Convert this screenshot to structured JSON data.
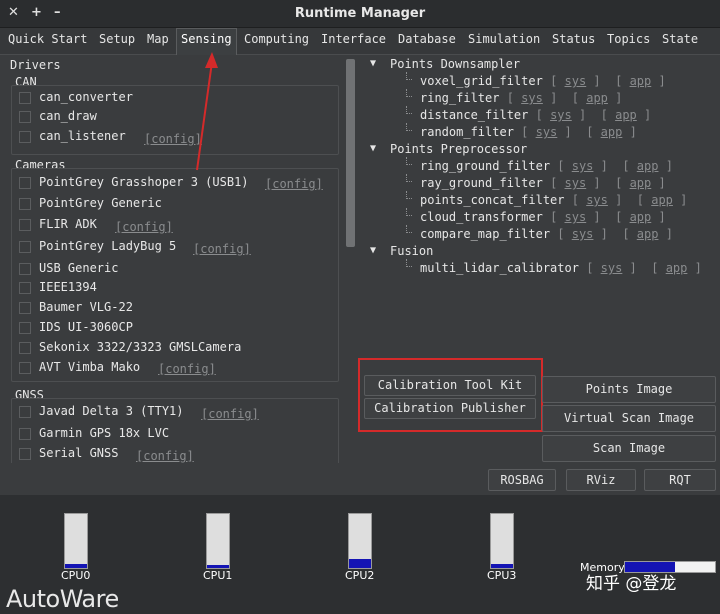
{
  "window": {
    "title": "Runtime Manager",
    "controls": {
      "close": "✕",
      "maximize": "+",
      "minimize": "–"
    }
  },
  "tabs": [
    {
      "label": "Quick Start"
    },
    {
      "label": "Setup"
    },
    {
      "label": "Map"
    },
    {
      "label": "Sensing",
      "active": true
    },
    {
      "label": "Computing"
    },
    {
      "label": "Interface"
    },
    {
      "label": "Database"
    },
    {
      "label": "Simulation"
    },
    {
      "label": "Status"
    },
    {
      "label": "Topics"
    },
    {
      "label": "State"
    }
  ],
  "drivers": {
    "title": "Drivers",
    "can": {
      "title": "CAN",
      "items": [
        "can_converter",
        "can_draw",
        "can_listener"
      ],
      "config_label": "[config]"
    },
    "cameras": {
      "title": "Cameras",
      "items": [
        "PointGrey Grasshoper 3 (USB1)",
        "PointGrey Generic",
        "FLIR ADK",
        "PointGrey LadyBug 5",
        "USB Generic",
        "IEEE1394",
        "Baumer VLG-22",
        "IDS UI-3060CP",
        "Sekonix 3322/3323 GMSLCamera",
        "AVT Vimba Mako"
      ],
      "config_label": "[config]"
    },
    "gnss": {
      "title": "GNSS",
      "items": [
        "Javad Delta 3 (TTY1)",
        "Garmin GPS 18x LVC",
        "Serial GNSS"
      ],
      "config_label": "[config]"
    }
  },
  "tree": {
    "sys_label": "sys",
    "app_label": "app",
    "groups": [
      {
        "label": "Points Downsampler",
        "children": [
          "voxel_grid_filter",
          "ring_filter",
          "distance_filter",
          "random_filter"
        ]
      },
      {
        "label": "Points Preprocessor",
        "children": [
          "ring_ground_filter",
          "ray_ground_filter",
          "points_concat_filter",
          "cloud_transformer",
          "compare_map_filter"
        ]
      },
      {
        "label": "Fusion",
        "children": [
          "multi_lidar_calibrator"
        ]
      }
    ]
  },
  "buttons": {
    "calibration_tool_kit": "Calibration Tool Kit",
    "calibration_publisher": "Calibration Publisher",
    "points_image": "Points Image",
    "virtual_scan_image": "Virtual Scan Image",
    "scan_image": "Scan Image",
    "rosbag": "ROSBAG",
    "rviz": "RViz",
    "rqt": "RQT"
  },
  "status": {
    "cpus": [
      {
        "label": "CPU0",
        "usage": 0.08
      },
      {
        "label": "CPU1",
        "usage": 0.05
      },
      {
        "label": "CPU2",
        "usage": 0.17
      },
      {
        "label": "CPU3",
        "usage": 0.07
      }
    ],
    "memory": {
      "label": "Memory",
      "usage": 0.55
    }
  },
  "branding": {
    "logo": "AutoWare",
    "watermark": "知乎 @登龙"
  },
  "annotation_color": "#d42a2a"
}
